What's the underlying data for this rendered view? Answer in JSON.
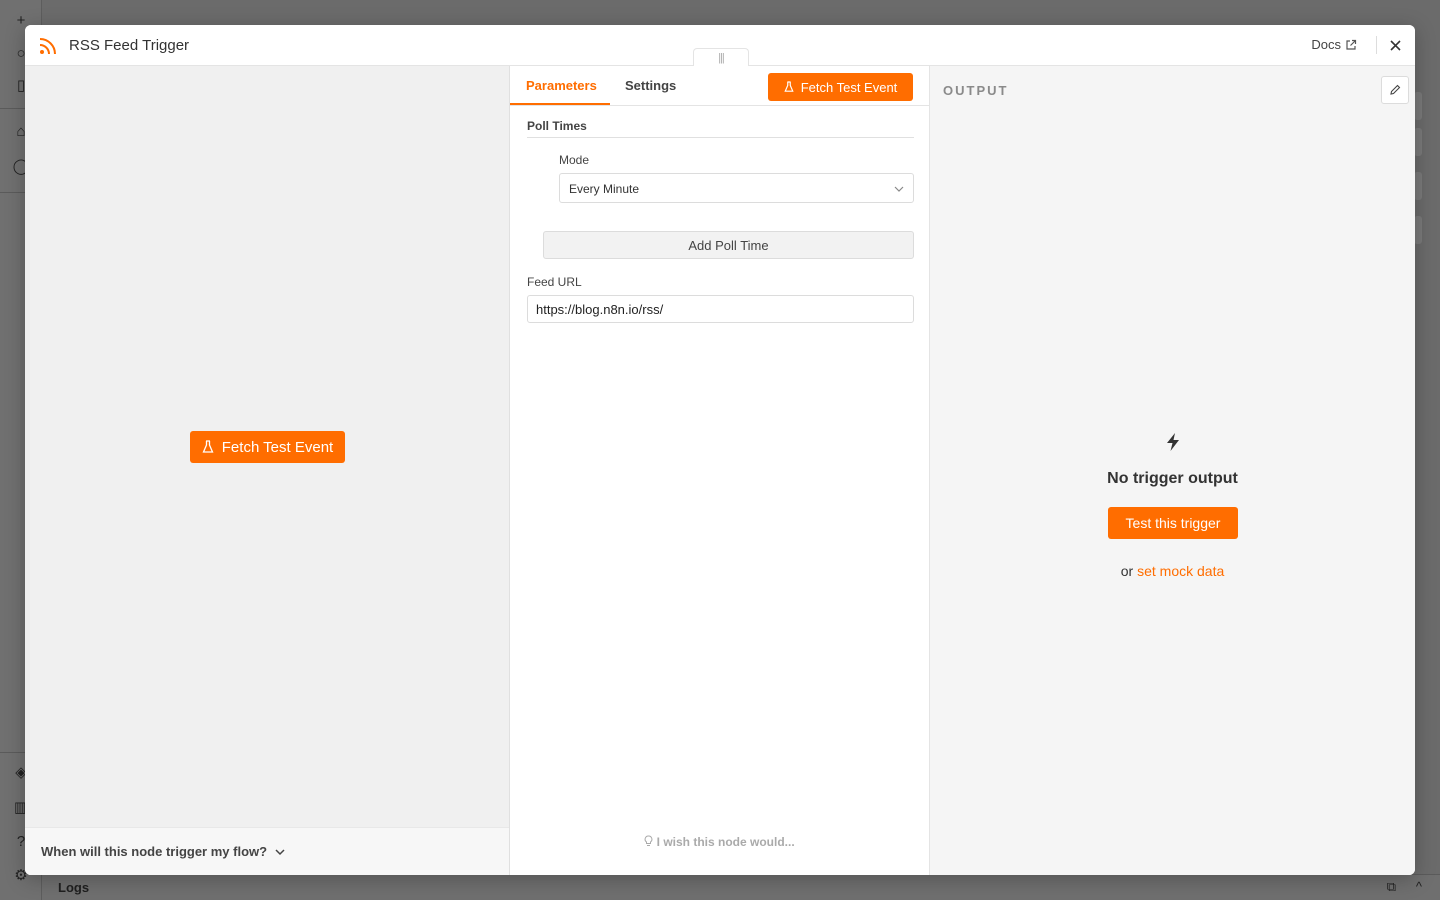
{
  "modal": {
    "title": "RSS Feed Trigger",
    "docs_label": "Docs",
    "accent_color": "#ff6d00"
  },
  "input_panel": {
    "fetch_button": "Fetch Test Event",
    "trigger_question": "When will this node trigger my flow?"
  },
  "params_panel": {
    "tabs": [
      {
        "label": "Parameters",
        "active": true
      },
      {
        "label": "Settings",
        "active": false
      }
    ],
    "fetch_button": "Fetch Test Event",
    "poll_times": {
      "title": "Poll Times",
      "mode_label": "Mode",
      "mode_value": "Every Minute",
      "add_button": "Add Poll Time"
    },
    "feed_url": {
      "label": "Feed URL",
      "value": "https://blog.n8n.io/rss/"
    },
    "wish_text": "I wish this node would..."
  },
  "output_panel": {
    "title": "OUTPUT",
    "empty_title": "No trigger output",
    "test_button": "Test this trigger",
    "mock_prefix": "or",
    "mock_link": "set mock data"
  },
  "background": {
    "logs_label": "Logs"
  },
  "icons": [
    "rss-icon",
    "external-link-icon",
    "close-icon",
    "flask-icon",
    "chevron-down-icon",
    "pencil-icon",
    "bolt-icon",
    "lightbulb-icon"
  ]
}
